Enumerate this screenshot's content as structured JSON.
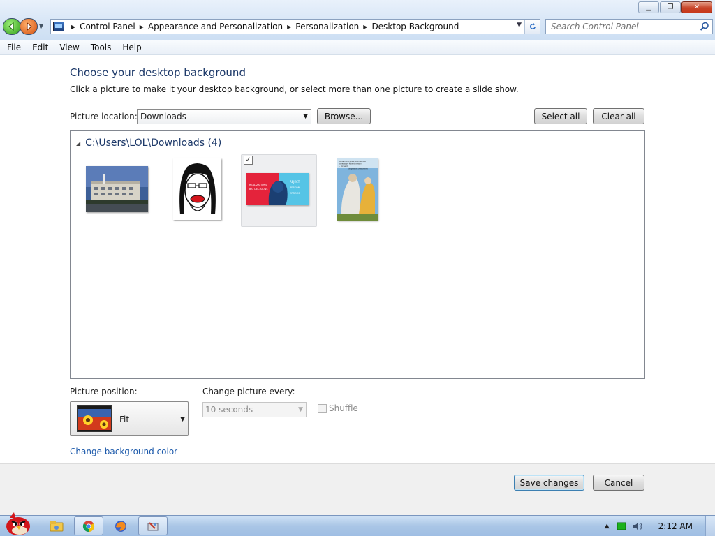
{
  "window": {
    "title_buttons": {
      "minimize": "minimize-icon",
      "restore": "restore-icon",
      "close": "close-icon"
    }
  },
  "address": {
    "breadcrumbs": [
      "Control Panel",
      "Appearance and Personalization",
      "Personalization",
      "Desktop Background"
    ],
    "search_placeholder": "Search Control Panel"
  },
  "menu": [
    "File",
    "Edit",
    "View",
    "Tools",
    "Help"
  ],
  "page": {
    "heading": "Choose your desktop background",
    "subtext": "Click a picture to make it your desktop background, or select more than one picture to create a slide show.",
    "picture_location_label": "Picture location:",
    "picture_location_value": "Downloads",
    "browse_label": "Browse...",
    "select_all_label": "Select all",
    "clear_all_label": "Clear all",
    "group_label": "C:\\Users\\LOL\\Downloads (4)",
    "thumbnails": [
      {
        "name": "building-photo",
        "selected": false
      },
      {
        "name": "cartoon-face",
        "selected": false
      },
      {
        "name": "red-blue-portrait-poster",
        "selected": true,
        "texts": [
          "REALIZATIONS",
          "BIG DECISIONS",
          "REJECT",
          "PERSON",
          "ERRORS"
        ]
      },
      {
        "name": "poster-with-figures",
        "selected": false,
        "texts": [
          "Obtain the prize, then let the",
          "clowns be fooled, Kotov!",
          "- Richard",
          "Stephanos Shevchenko"
        ]
      }
    ],
    "picture_position_label": "Picture position:",
    "picture_position_value": "Fit",
    "change_picture_label": "Change picture every:",
    "interval_value": "10 seconds",
    "shuffle_label": "Shuffle",
    "change_bg_color_link": "Change background color"
  },
  "footer": {
    "save_label": "Save changes",
    "cancel_label": "Cancel"
  },
  "taskbar": {
    "apps": [
      "start-orb",
      "explorer-icon",
      "chrome-icon",
      "firefox-icon",
      "control-panel-icon"
    ],
    "clock": "2:12 AM"
  },
  "colors": {
    "heading": "#1e3a6a",
    "link": "#1d5aab",
    "taskbar": "#aac6e6"
  }
}
